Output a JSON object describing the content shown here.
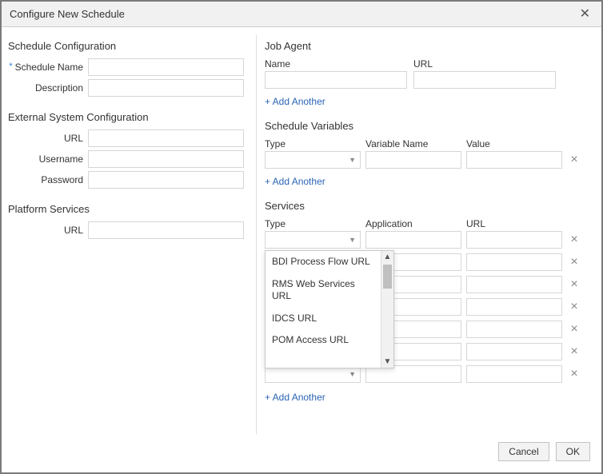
{
  "title": "Configure New Schedule",
  "left": {
    "schedule_cfg": {
      "heading": "Schedule Configuration",
      "name_label": "Schedule Name",
      "name_value": "",
      "desc_label": "Description",
      "desc_value": ""
    },
    "ext_sys": {
      "heading": "External System Configuration",
      "url_label": "URL",
      "url_value": "",
      "user_label": "Username",
      "user_value": "",
      "pass_label": "Password",
      "pass_value": ""
    },
    "platform": {
      "heading": "Platform Services",
      "url_label": "URL",
      "url_value": ""
    }
  },
  "right": {
    "job_agent": {
      "heading": "Job Agent",
      "name_hdr": "Name",
      "url_hdr": "URL",
      "rows": [
        {
          "name": "",
          "url": ""
        }
      ],
      "add_label": "+ Add Another"
    },
    "sched_vars": {
      "heading": "Schedule Variables",
      "type_hdr": "Type",
      "name_hdr": "Variable Name",
      "value_hdr": "Value",
      "rows": [
        {
          "type": "",
          "name": "",
          "value": ""
        }
      ],
      "add_label": "+ Add Another"
    },
    "services": {
      "heading": "Services",
      "type_hdr": "Type",
      "app_hdr": "Application",
      "url_hdr": "URL",
      "rows": [
        {
          "type": "",
          "app": "",
          "url": ""
        },
        {
          "type": "",
          "app": "",
          "url": ""
        },
        {
          "type": "",
          "app": "",
          "url": ""
        },
        {
          "type": "",
          "app": "",
          "url": ""
        },
        {
          "type": "",
          "app": "",
          "url": ""
        },
        {
          "type": "",
          "app": "",
          "url": ""
        },
        {
          "type": "",
          "app": "",
          "url": ""
        }
      ],
      "add_label": "+ Add Another",
      "type_options": [
        "BDI Process Flow URL",
        "RMS Web Services URL",
        "IDCS URL",
        "POM Access URL"
      ]
    }
  },
  "footer": {
    "cancel": "Cancel",
    "ok": "OK"
  }
}
